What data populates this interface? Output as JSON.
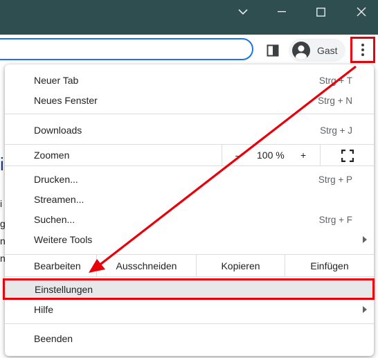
{
  "window": {
    "title_bar_color": "#2e4e4f",
    "controls": [
      "chevron-down-icon",
      "minimize-icon",
      "maximize-icon",
      "close-icon"
    ]
  },
  "toolbar": {
    "profile_label": "Gast",
    "accent": "#1a73e8"
  },
  "background_page": {
    "fragments": [
      "i",
      "i",
      "g",
      "n",
      "n"
    ]
  },
  "menu": {
    "items": [
      {
        "label": "Neuer Tab",
        "shortcut": "Strg + T"
      },
      {
        "label": "Neues Fenster",
        "shortcut": "Strg + N"
      },
      {
        "label": "Downloads",
        "shortcut": "Strg + J"
      },
      {
        "label": "Drucken...",
        "shortcut": "Strg + P"
      },
      {
        "label": "Streamen...",
        "shortcut": ""
      },
      {
        "label": "Suchen...",
        "shortcut": "Strg + F"
      },
      {
        "label": "Weitere Tools",
        "shortcut": ""
      },
      {
        "label": "Einstellungen",
        "shortcut": ""
      },
      {
        "label": "Hilfe",
        "shortcut": ""
      },
      {
        "label": "Beenden",
        "shortcut": ""
      }
    ],
    "zoom": {
      "label": "Zoomen",
      "minus": "–",
      "value": "100 %",
      "plus": "+"
    },
    "edit": {
      "label": "Bearbeiten",
      "cut": "Ausschneiden",
      "copy": "Kopieren",
      "paste": "Einfügen"
    }
  },
  "annotation": {
    "highlight_color": "#e8000b",
    "highlighted_item": "Einstellungen"
  }
}
